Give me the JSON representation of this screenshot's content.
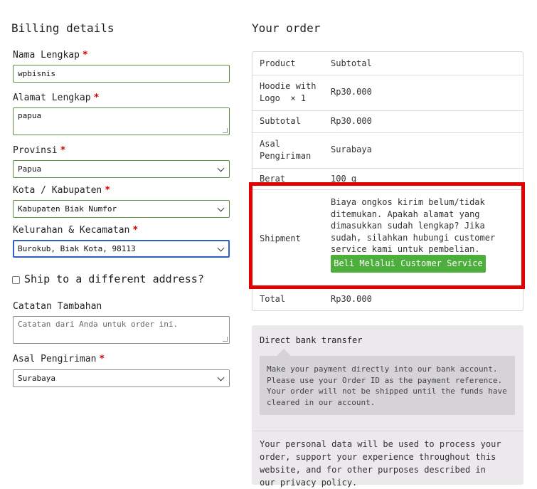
{
  "billing": {
    "title": "Billing details",
    "full_name": {
      "label": "Nama Lengkap",
      "value": "wpbisnis"
    },
    "address": {
      "label": "Alamat Lengkap",
      "value": "papua"
    },
    "province": {
      "label": "Provinsi",
      "value": "Papua"
    },
    "city": {
      "label": "Kota / Kabupaten",
      "value": "Kabupaten Biak Numfor"
    },
    "district": {
      "label": "Kelurahan & Kecamatan",
      "value": "Burokub, Biak Kota, 98113"
    },
    "ship_different": "Ship to a different address?",
    "notes": {
      "label": "Catatan Tambahan",
      "placeholder": "Catatan dari Anda untuk order ini."
    },
    "origin": {
      "label": "Asal Pengiriman",
      "value": "Surabaya"
    },
    "required_mark": "*"
  },
  "order": {
    "title": "Your order",
    "header": {
      "product": "Product",
      "subtotal": "Subtotal"
    },
    "item": {
      "name": "Hoodie with Logo",
      "qty": "× 1",
      "price": "Rp30.000"
    },
    "subtotal": {
      "label": "Subtotal",
      "value": "Rp30.000"
    },
    "origin": {
      "label": "Asal Pengiriman",
      "value": "Surabaya"
    },
    "weight": {
      "label": "Berat",
      "value": "100 g"
    },
    "shipment": {
      "label": "Shipment",
      "message": "Biaya ongkos kirim belum/tidak ditemukan. Apakah alamat yang dimasukkan sudah lengkap? Jika sudah, silahkan hubungi customer service kami untuk pembelian.",
      "button": "Beli Melalui Customer Service"
    },
    "total": {
      "label": "Total",
      "value": "Rp30.000"
    }
  },
  "payment": {
    "method": "Direct bank transfer",
    "description": "Make your payment directly into our bank account. Please use your Order ID as the payment reference. Your order will not be shipped until the funds have cleared in our account.",
    "privacy": "Your personal data will be used to process your order, support your experience throughout this website, and for other purposes described in our privacy policy."
  },
  "colors": {
    "highlight": "#e20000",
    "button_green": "#4caf3c",
    "focus_blue": "#2f5ec4"
  }
}
